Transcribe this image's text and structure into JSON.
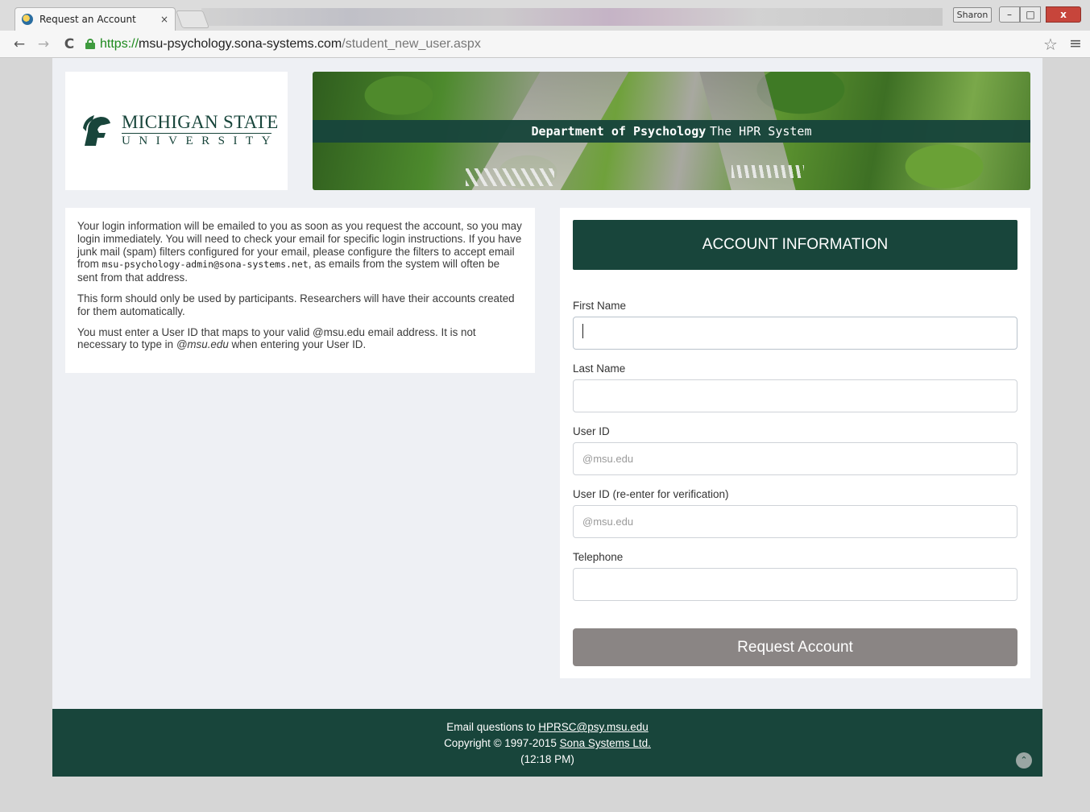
{
  "browser": {
    "tab_title": "Request an Account",
    "tab_close": "×",
    "profile_name": "Sharon",
    "url_scheme": "https://",
    "url_host": "msu-psychology.sona-systems.com",
    "url_path": "/student_new_user.aspx",
    "back": "←",
    "forward": "→",
    "reload": "C",
    "star": "☆",
    "menu": "≡",
    "win_min": "–",
    "win_max": "□",
    "win_close": "x"
  },
  "header": {
    "university_name": "MICHIGAN STATE",
    "university_sub": "UNIVERSITY",
    "department": "Department of Psychology",
    "system_name": "The HPR System"
  },
  "info": {
    "p1_a": "Your login information will be emailed to you as soon as you request the account, so you may login immediately. You will need to check your email for specific login instructions. If you have junk mail (spam) filters configured for your email, please configure the filters to accept email from ",
    "p1_email": "msu-psychology-admin@sona-systems.net",
    "p1_b": ", as emails from the system will often be sent from that address.",
    "p2": "This form should only be used by participants. Researchers will have their accounts created for them automatically.",
    "p3_a": "You must enter a User ID that maps to your valid @msu.edu email address. It is not necessary to type in ",
    "p3_em": "@msu.edu",
    "p3_b": " when entering your User ID."
  },
  "form": {
    "title": "ACCOUNT INFORMATION",
    "first_name_label": "First Name",
    "first_name_value": "",
    "last_name_label": "Last Name",
    "last_name_value": "",
    "user_id_label": "User ID",
    "user_id_placeholder": "@msu.edu",
    "user_id_verify_label": "User ID (re-enter for verification)",
    "user_id_verify_placeholder": "@msu.edu",
    "telephone_label": "Telephone",
    "telephone_value": "",
    "submit_label": "Request Account"
  },
  "footer": {
    "email_prefix": "Email questions to ",
    "email": "HPRSC@psy.msu.edu",
    "copyright_prefix": "Copyright © 1997-2015 ",
    "company": "Sona Systems Ltd.",
    "time": "(12:18 PM)",
    "scroll_top": "⌃"
  },
  "colors": {
    "brand_green": "#18453b",
    "page_bg": "#eef0f4",
    "button_gray": "#8a8584"
  }
}
